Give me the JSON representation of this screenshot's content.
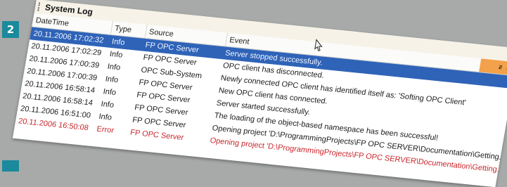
{
  "badge": {
    "step": "2"
  },
  "window": {
    "title": "System Log"
  },
  "columns": {
    "datetime": "DateTime",
    "type": "Type",
    "source": "Source",
    "event": "Event"
  },
  "controls": {
    "pin": "ᵶ",
    "close": "×"
  },
  "rows": [
    {
      "datetime": "20.11.2006 17:02:32",
      "type": "Info",
      "source": "FP OPC Server",
      "event": "Server stopped successfully."
    },
    {
      "datetime": "20.11.2006 17:02:29",
      "type": "Info",
      "source": "FP OPC Server",
      "event": "OPC client has disconnected."
    },
    {
      "datetime": "20.11.2006 17:00:39",
      "type": "Info",
      "source": "OPC Sub-System",
      "event": "Newly connected OPC client has identified itself as: 'Softing OPC Client'"
    },
    {
      "datetime": "20.11.2006 17:00:39",
      "type": "Info",
      "source": "FP OPC Server",
      "event": "New OPC client has connected."
    },
    {
      "datetime": "20.11.2006 16:58:14",
      "type": "Info",
      "source": "FP OPC Server",
      "event": "Server started successfully."
    },
    {
      "datetime": "20.11.2006 16:58:14",
      "type": "Info",
      "source": "FP OPC Server",
      "event": "The loading of the object-based namespace has been successful!"
    },
    {
      "datetime": "20.11.2006 16:51:00",
      "type": "Info",
      "source": "FP OPC Server",
      "event": "Opening project 'D:\\ProgrammingProjects\\FP OPC SERVER\\Documentation\\Getting..."
    },
    {
      "datetime": "20.11.2006 16:50:08",
      "type": "Error",
      "source": "FP OPC Server",
      "event": "Opening project 'D:\\ProgrammingProjects\\FP OPC SERVER\\Documentation\\Getting..."
    }
  ],
  "colors": {
    "selection": "#2e63b8",
    "error": "#c8262b",
    "header_accent": "#f3a14a",
    "badge": "#1a8a9c"
  }
}
